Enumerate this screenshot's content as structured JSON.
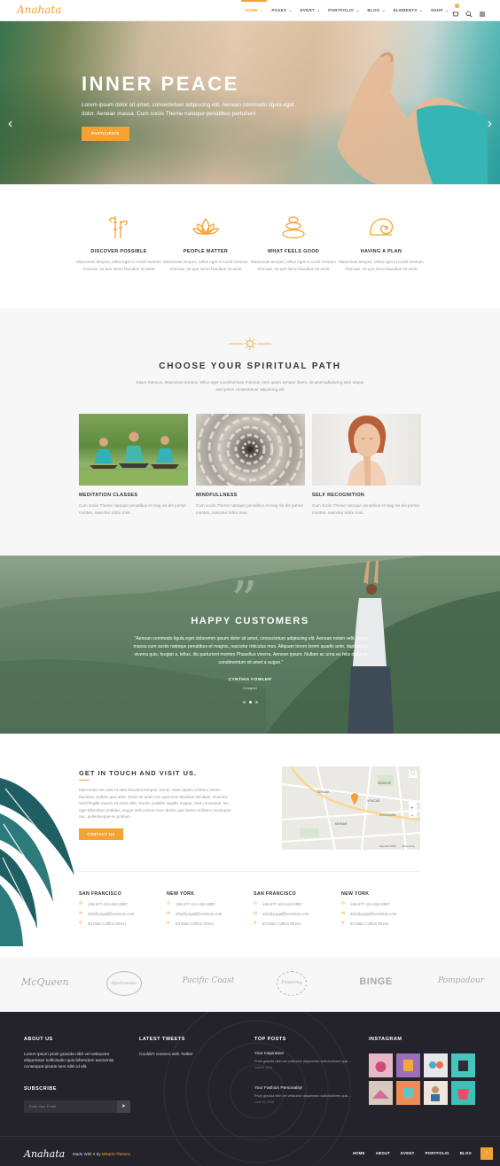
{
  "header": {
    "logo": "Anahata",
    "nav": [
      {
        "label": "HOME",
        "active": true
      },
      {
        "label": "PAGES",
        "active": false
      },
      {
        "label": "EVENT",
        "active": false
      },
      {
        "label": "PORTFOLIO",
        "active": false
      },
      {
        "label": "BLOG",
        "active": false
      },
      {
        "label": "ELEMENTS",
        "active": false
      },
      {
        "label": "SHOP",
        "active": false
      }
    ],
    "cart_count": "0",
    "icons": [
      "cart-icon",
      "search-icon",
      "menu-icon"
    ]
  },
  "hero": {
    "title": "INNER PEACE",
    "text": "Lorem ipsum dolor sit amet, consectetuer adipiscing elit. Aenean commodo ligula eget dolor. Aenean massa. Cum sociis Theme natoque penatibus parturient",
    "button": "PARTICIPATE"
  },
  "features": [
    {
      "icon": "bamboo-icon",
      "title": "DISCOVER POSSIBLE",
      "desc": "Maecenas tempus, tellus eget si condi mentum rhoncus, se quo semo faucibus sit amet"
    },
    {
      "icon": "lotus-icon",
      "title": "PEOPLE MATTER",
      "desc": "Maecenas tempus, tellus eget si condi mentum rhoncus, se quo semo faucibus sit amet"
    },
    {
      "icon": "stones-icon",
      "title": "WHAT FEELS GOOD",
      "desc": "Maecenas tempus, tellus eget si condi mentum rhoncus, se quo semo faucibus sit amet"
    },
    {
      "icon": "shell-icon",
      "title": "HAVING A PLAN",
      "desc": "Maecenas tempus, tellus eget si condi mentum rhoncus, se quo semo faucibus sit amet"
    }
  ],
  "path": {
    "title": "CHOOSE YOUR SPIRITUAL PATH",
    "subtitle": "Etiam rhoncus. Maecenas tempus, tellus eget condimentum rhoncus, sem quam semper libero, sit amet adipiscing sem neque sed ipsum consectetuer adipiscing elit",
    "cards": [
      {
        "title": "MEDITATION CLASSES",
        "desc": "Cum sociis Theme natoque penatibus et mag nis dis parturi montes, nascetur ridicu mus."
      },
      {
        "title": "MINDFULLNESS",
        "desc": "Cum sociis Theme natoque penatibus et mag nis dis parturi montes, nascetur ridicu mus."
      },
      {
        "title": "SELF RECOGNITION",
        "desc": "Cum sociis Theme natoque penatibus et mag nis dis parturi montes, nascetur ridicu mus."
      }
    ]
  },
  "testimonial": {
    "title": "HAPPY CUSTOMERS",
    "quote": "\"Aenean commodo ligula eget doloremm ipsum dolor sit amet, consectetuer adipiscing elit. Aenean nolsin velit elendi massa cum sociis natoque penatibus et magnis, nascetur ridiculus mus. Aliquam lorem lorem quadis ante, dapibus in, viverra quis, feugiat a, tellus. dis parturient montes Phasellus viverra. Aenean ipsum. Nullam ac urna eu felis dapibus condimentum sit amet a augue.\"",
    "name": "CYNTHIA FOWLER",
    "role": "Designer"
  },
  "contact": {
    "title": "GET IN TOUCH AND VISIT US.",
    "text": "Maecenas nec odio et ante tincidunt tempus. Donec vitae sapien ut libero venen faucibus. Nullam quis ante. Etiam sit amet orci eget eros faucibus tincidunt. Duis leo. Sed fringilla mauris sit amet nibh. Donec sodales sagittis magna. Sed consequat, leo eget bibendum sodales, augue velit cursus nunc donec quis lorem ut libero consequat nec, pellentesque eu pretium.",
    "button": "CONTACT US",
    "map_labels": [
      "VRAČAR",
      "DEDINJE",
      "SENJAK",
      "NEIMAR",
      "ZVEZDARA",
      "Map data ©2019",
      "Terms of Use"
    ],
    "offices": [
      {
        "city": "SAN FRANCISCO",
        "phone": "156-677-124-442-2887",
        "email": "info@yoga@business.com",
        "address": "84 Main Collins Street"
      },
      {
        "city": "NEW YORK",
        "phone": "156-677-124-442-2887",
        "email": "info@yoga@business.com",
        "address": "84 Main Collins Street"
      },
      {
        "city": "SAN FRANCISCO",
        "phone": "156-677-124-442-2887",
        "email": "info@yoga@business.com",
        "address": "84 Main Collins Street"
      },
      {
        "city": "NEW YORK",
        "phone": "156-677-124-442-2887",
        "email": "info@yoga@business.com",
        "address": "84 Main Collins Street"
      }
    ]
  },
  "clients": [
    "McQueen",
    "Apolcnoseo",
    "Pacific Coast",
    "Flowering",
    "BINGE",
    "Pompadour"
  ],
  "footer": {
    "about_title": "ABOUT US",
    "about_text": "Lorem ipsum proin gravida nibh vel veliauctor aliquenean sollicitudin quis bibendum auctornisi consequat ipsutis sem nibh id elit.",
    "subscribe_title": "SUBSCRIBE",
    "subscribe_placeholder": "Enter Your Email",
    "tweets_title": "LATEST TWEETS",
    "tweets_text": "Couldn't connect with Twitter",
    "posts_title": "TOP POSTS",
    "posts": [
      {
        "title": "Your Inspiration",
        "text": "Proin gravida nibh vel veliauctor aliquenean sollicitudinem quis ...",
        "date": "June 8, 2016"
      },
      {
        "title": "Your Fashion Personality!",
        "text": "Proin gravida nibh vel veliauctor aliquenean sollicitudinem quis ...",
        "date": "June 16, 2016"
      }
    ],
    "instagram_title": "INSTAGRAM",
    "logo": "Anahata",
    "made_with": "Made With",
    "by": "by",
    "brand": "Mikado-Themes",
    "nav": [
      "HOME",
      "ABOUT",
      "EVENT",
      "PORTFOLIO",
      "BLOG"
    ]
  },
  "colors": {
    "accent": "#f4a233",
    "footer_bg": "#24232b"
  }
}
